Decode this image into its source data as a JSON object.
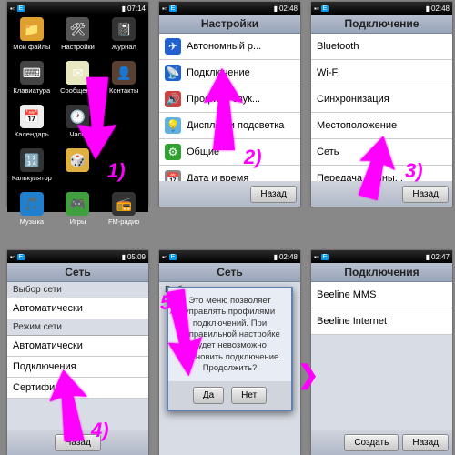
{
  "status": {
    "time1": "07:14",
    "time2": "02:48",
    "time3": "02:48",
    "time4": "05:09",
    "time5": "02:48",
    "time6": "02:47",
    "e": "E",
    "sig": "▪▫"
  },
  "s1": {
    "apps": [
      {
        "l": "Мои файлы",
        "c": "#e0a030",
        "i": "📁"
      },
      {
        "l": "Настройки",
        "c": "#555",
        "i": "🛠"
      },
      {
        "l": "Журнал",
        "c": "#333",
        "i": "📓"
      },
      {
        "l": "Клавиатура",
        "c": "#444",
        "i": "⌨"
      },
      {
        "l": "Сообщен...",
        "c": "#e8e8c0",
        "i": "✉"
      },
      {
        "l": "Контакты",
        "c": "#5a4030",
        "i": "👤"
      },
      {
        "l": "Календарь",
        "c": "#eee",
        "i": "📅"
      },
      {
        "l": "Часы",
        "c": "#333",
        "i": "🕐"
      },
      {
        "l": "",
        "c": "transparent",
        "i": ""
      },
      {
        "l": "Калькулятор",
        "c": "#333",
        "i": "🔢"
      },
      {
        "l": "",
        "c": "#e0b040",
        "i": "🎲"
      },
      {
        "l": "",
        "c": "transparent",
        "i": ""
      },
      {
        "l": "Музыка",
        "c": "#2080d0",
        "i": "🎵"
      },
      {
        "l": "Игры",
        "c": "#40a040",
        "i": "🎮"
      },
      {
        "l": "FM-радио",
        "c": "#333",
        "i": "📻"
      }
    ]
  },
  "s2": {
    "title": "Настройки",
    "back": "Назад",
    "items": [
      {
        "l": "Автономный р...",
        "c": "#2060d0",
        "i": "✈"
      },
      {
        "l": "Подключение",
        "c": "#2060d0",
        "i": "📡"
      },
      {
        "l": "Профили звук...",
        "c": "#d04040",
        "i": "🔊"
      },
      {
        "l": "Дисплей и подсветка",
        "c": "#60b0e0",
        "i": "💡"
      },
      {
        "l": "Общие",
        "c": "#30a030",
        "i": "⚙"
      },
      {
        "l": "Дата и время",
        "c": "#888",
        "i": "📅"
      }
    ]
  },
  "s3": {
    "title": "Подключение",
    "back": "Назад",
    "items": [
      "Bluetooth",
      "Wi-Fi",
      "Синхронизация",
      "Местоположение",
      "Сеть",
      "Передача данны..."
    ]
  },
  "s4": {
    "title": "Сеть",
    "back": "Назад",
    "h1": "Выбор сети",
    "v1": "Автоматически",
    "h2": "Режим сети",
    "v2": "Автоматически",
    "i1": "Подключения",
    "i2": "Сертификаты"
  },
  "s5": {
    "title": "Сеть",
    "sub": "Выбор сети",
    "dlg": "Это меню позволяет управлять профилями подключений. При неправильной настройке будет невозможно установить подключение. Продолжить?",
    "yes": "Да",
    "no": "Нет"
  },
  "s6": {
    "title": "Подключения",
    "create": "Создать",
    "back": "Назад",
    "items": [
      "Beeline MMS",
      "Beeline Internet"
    ]
  },
  "nums": {
    "n1": "1)",
    "n2": "2)",
    "n3": "3)",
    "n4": "4)",
    "n5": "5)"
  }
}
